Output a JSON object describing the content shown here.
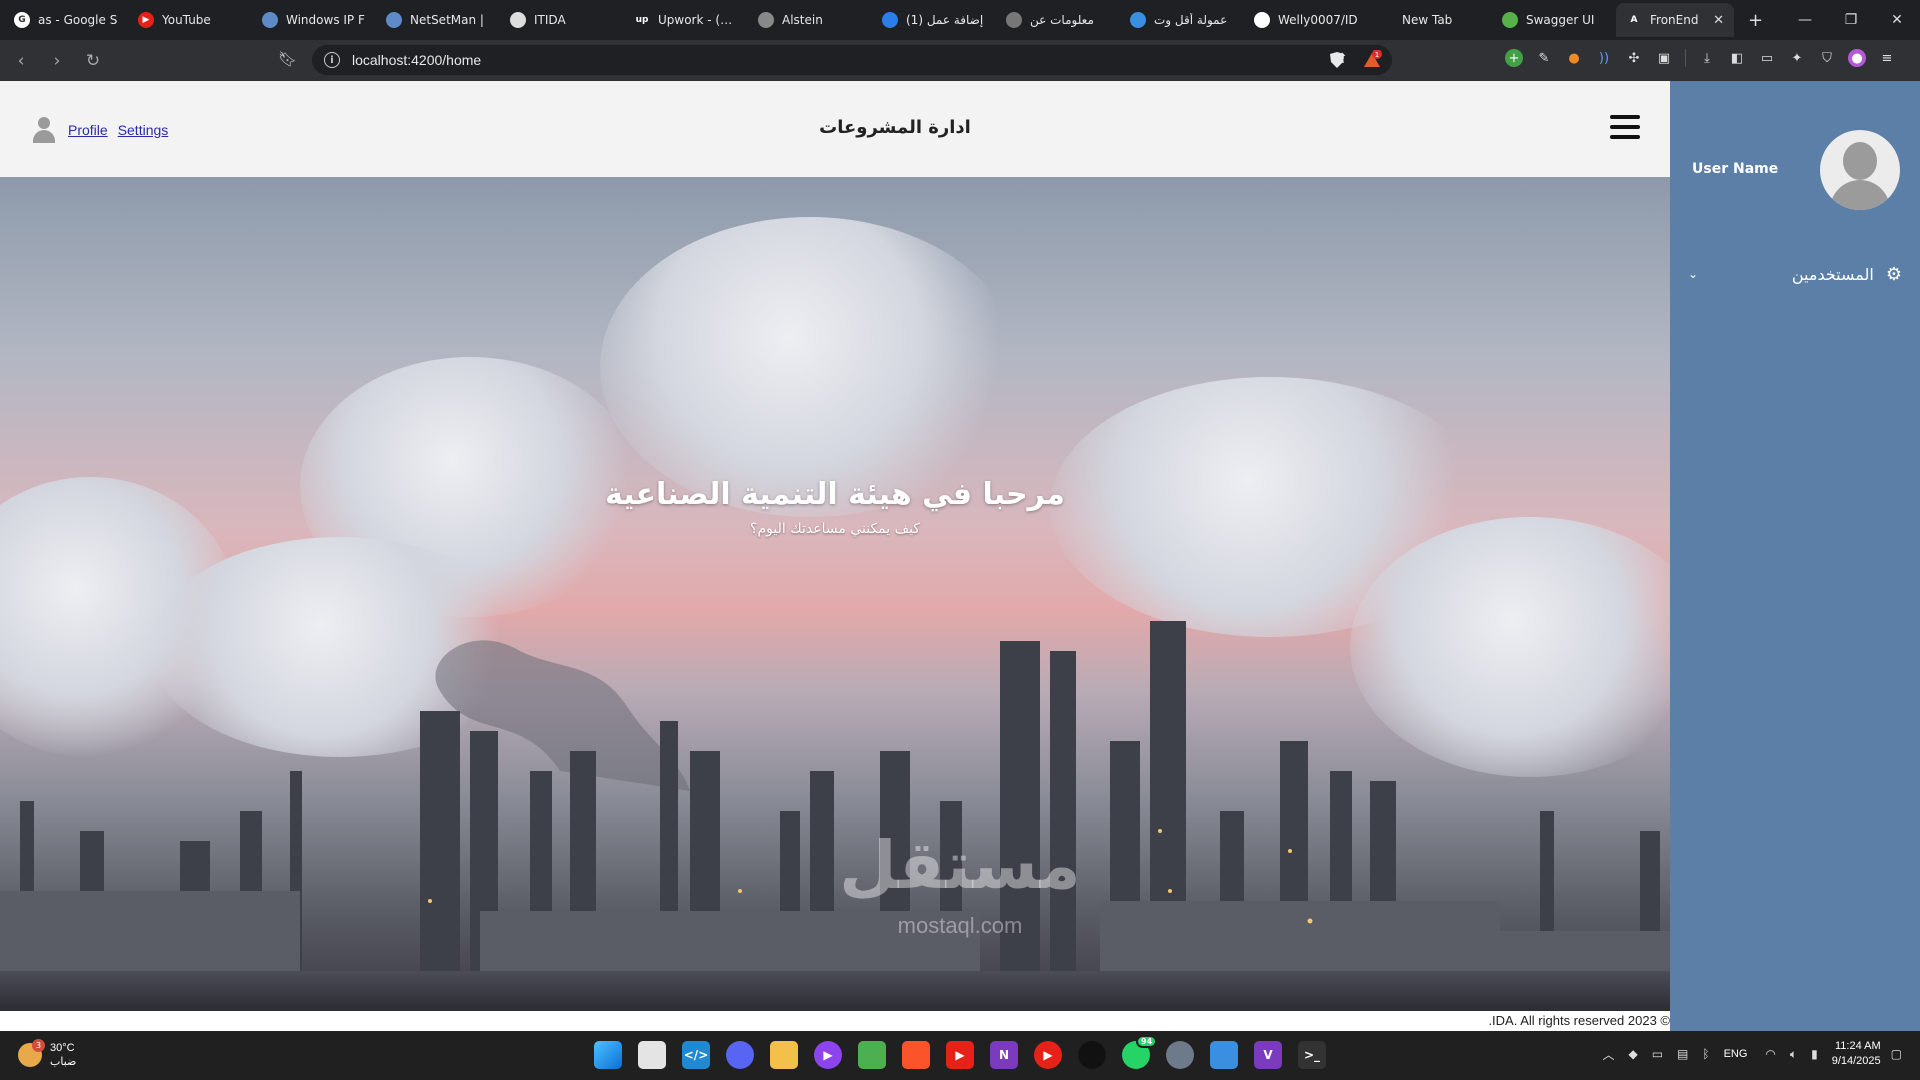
{
  "browser": {
    "tabs": [
      {
        "title": "as - Google S",
        "favicon_color": "#ffffff",
        "favicon_text": "G"
      },
      {
        "title": "YouTube",
        "favicon_color": "#e62117",
        "favicon_text": "▶"
      },
      {
        "title": "Windows IP F",
        "favicon_color": "#5f8ac8",
        "favicon_text": ""
      },
      {
        "title": "NetSetMan | ",
        "favicon_color": "#5f8ac8",
        "favicon_text": ""
      },
      {
        "title": "ITIDA",
        "favicon_color": "#dddddd",
        "favicon_text": ""
      },
      {
        "title": "Upwork - (asp",
        "favicon_color": "#1f2023",
        "favicon_text": "up"
      },
      {
        "title": "Alstein",
        "favicon_color": "#888888",
        "favicon_text": ""
      },
      {
        "title": "(1) إضافة عمل",
        "favicon_color": "#2b7de9",
        "favicon_text": ""
      },
      {
        "title": "معلومات عن",
        "favicon_color": "#777777",
        "favicon_text": ""
      },
      {
        "title": "عمولة أقل وت",
        "favicon_color": "#3a8fe0",
        "favicon_text": ""
      },
      {
        "title": "Welly0007/ID",
        "favicon_color": "#ffffff",
        "favicon_text": ""
      },
      {
        "title": "New Tab",
        "favicon_color": "",
        "favicon_text": ""
      },
      {
        "title": "Swagger UI",
        "favicon_color": "#57b04a",
        "favicon_text": ""
      }
    ],
    "active_tab": {
      "title": "FronEnd",
      "favicon_text": "A",
      "close": "✕"
    },
    "new_tab": "+",
    "window_controls": {
      "minimize": "—",
      "restore": "❐",
      "close": "✕"
    },
    "url": "localhost:4200/home",
    "nav": {
      "back": "‹",
      "forward": "›",
      "reload": "↻"
    },
    "rewards_badge": "1"
  },
  "header": {
    "profile_link": "Profile",
    "settings_link": "Settings",
    "title": "ادارة المشروعات"
  },
  "hero": {
    "title": "مرحبا في هيئة التنمية الصناعية",
    "subtitle": "كيف يمكنني مساعدتك اليوم؟",
    "watermark": "مستقل",
    "watermark_url": "mostaql.com"
  },
  "footer": {
    "text": ".IDA. All rights reserved 2023 ©"
  },
  "sidebar": {
    "username": "User Name",
    "menu_item": "المستخدمين",
    "chevron": "⌄",
    "gear": "⚙"
  },
  "taskbar": {
    "weather_temp": "30°C",
    "weather_desc": "ضباب",
    "weather_badge": "3",
    "whatsapp_badge": "94",
    "lang": "ENG",
    "time": "11:24 AM",
    "date": "9/14/2025"
  }
}
